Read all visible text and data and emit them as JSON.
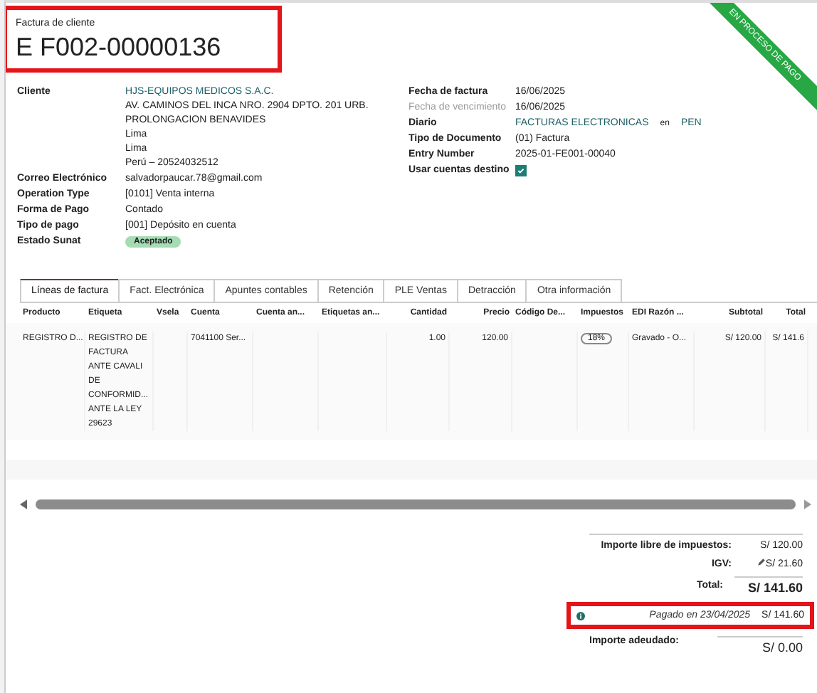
{
  "header": {
    "subtitle": "Factura de cliente",
    "title": "E F002-00000136",
    "highlighted": true
  },
  "ribbon": {
    "label": "EN PROCESO DE PAGO"
  },
  "left_fields": [
    {
      "label": "Cliente",
      "kind": "link",
      "lines": [
        "HJS-EQUIPOS MEDICOS S.A.C.",
        "AV. CAMINOS DEL INCA NRO. 2904 DPTO. 201 URB.",
        "PROLONGACION BENAVIDES",
        "Lima",
        "Lima",
        "Perú – 20524032512"
      ]
    },
    {
      "label": "Correo Electrónico",
      "kind": "text",
      "lines": [
        "salvadorpaucar.78@gmail.com"
      ]
    },
    {
      "label": "Operation Type",
      "kind": "text",
      "lines": [
        "[0101] Venta interna"
      ]
    },
    {
      "label": "Forma de Pago",
      "kind": "text",
      "lines": [
        "Contado"
      ]
    },
    {
      "label": "Tipo de pago",
      "kind": "text",
      "lines": [
        "[001] Depósito en cuenta"
      ]
    },
    {
      "label": "Estado Sunat",
      "kind": "badge",
      "lines": [
        "Aceptado"
      ]
    }
  ],
  "right_fields": [
    {
      "label": "Fecha de factura",
      "kind": "text",
      "muted": false,
      "value": "16/06/2025"
    },
    {
      "label": "Fecha de vencimiento",
      "kind": "text",
      "muted": true,
      "value": "16/06/2025"
    },
    {
      "label": "Diario",
      "kind": "journal",
      "muted": false,
      "value": "FACTURAS ELECTRONICAS",
      "joiner": "en",
      "currency": "PEN"
    },
    {
      "label": "Tipo de Documento",
      "kind": "text",
      "muted": false,
      "value": "(01) Factura"
    },
    {
      "label": "Entry Number",
      "kind": "text",
      "muted": false,
      "value": "2025-01-FE001-00040"
    },
    {
      "label": "Usar cuentas destino",
      "kind": "checkbox",
      "muted": false,
      "checked": true
    }
  ],
  "tabs": [
    {
      "label": "Líneas de factura",
      "selected": true
    },
    {
      "label": "Fact. Electrónica",
      "selected": false
    },
    {
      "label": "Apuntes contables",
      "selected": false
    },
    {
      "label": "Retención",
      "selected": false
    },
    {
      "label": "PLE Ventas",
      "selected": false
    },
    {
      "label": "Detracción",
      "selected": false
    },
    {
      "label": "Otra información",
      "selected": false
    }
  ],
  "table": {
    "columns": [
      "Producto",
      "Etiqueta",
      "Vsela",
      "Cuenta",
      "Cuenta an...",
      "Etiquetas an...",
      "Cantidad",
      "Precio",
      "Código De...",
      "Impuestos",
      "EDI Razón ...",
      "Subtotal",
      "Total"
    ],
    "rows": [
      {
        "cells": [
          {
            "text": "REGISTRO D..."
          },
          {
            "lines": [
              "REGISTRO DE",
              "FACTURA",
              "ANTE CAVALI",
              "DE",
              "CONFORMID...",
              "ANTE LA LEY",
              "29623"
            ]
          },
          {
            "text": ""
          },
          {
            "text": "7041100 Ser..."
          },
          {
            "text": ""
          },
          {
            "text": ""
          },
          {
            "text": "1.00"
          },
          {
            "text": "120.00"
          },
          {
            "text": ""
          },
          {
            "text": "18%",
            "kind": "tag"
          },
          {
            "text": "Gravado - O..."
          },
          {
            "text": "S/ 120.00"
          },
          {
            "text": "S/ 141.6"
          }
        ]
      }
    ]
  },
  "totals": {
    "lines": [
      {
        "label": "Importe libre de impuestos:",
        "value": "S/ 120.00",
        "kind": "plain"
      },
      {
        "label": "IGV:",
        "value": "S/ 21.60",
        "kind": "editable"
      },
      {
        "label": "Total:",
        "value": "S/ 141.60",
        "kind": "total"
      }
    ],
    "payment": {
      "text": "Pagado en 23/04/2025",
      "amount": "S/ 141.60",
      "highlighted": true
    },
    "due": {
      "label": "Importe adeudado:",
      "value": "S/ 0.00"
    }
  }
}
